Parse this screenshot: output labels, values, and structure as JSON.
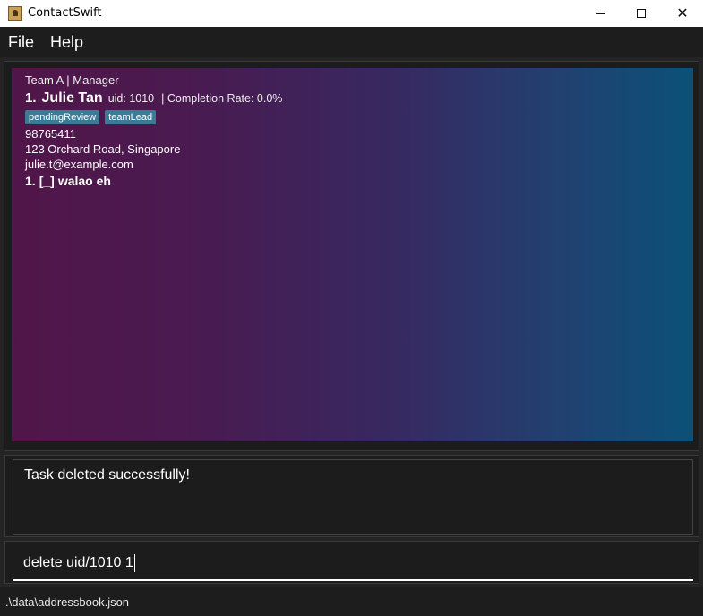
{
  "window": {
    "title": "ContactSwift"
  },
  "menu": {
    "file": "File",
    "help": "Help"
  },
  "contact": {
    "team_role": "Team A | Manager",
    "index": "1.",
    "name": "Julie Tan",
    "uid": "uid: 1010",
    "completion": "| Completion Rate: 0.0%",
    "tags": [
      "pendingReview",
      "teamLead"
    ],
    "phone": "98765411",
    "address": "123 Orchard Road, Singapore",
    "email": "julie.t@example.com",
    "task": {
      "index": "1.",
      "checkbox": "[_]",
      "label": "walao eh"
    }
  },
  "result": {
    "message": "Task deleted successfully!"
  },
  "command": {
    "value": "delete uid/1010 1"
  },
  "status": {
    "path": ".\\data\\addressbook.json"
  },
  "colors": {
    "card_gradient_start": "#511649",
    "card_gradient_end": "#0b5178",
    "tag_bg": "#3a7c95",
    "background": "#242424"
  }
}
